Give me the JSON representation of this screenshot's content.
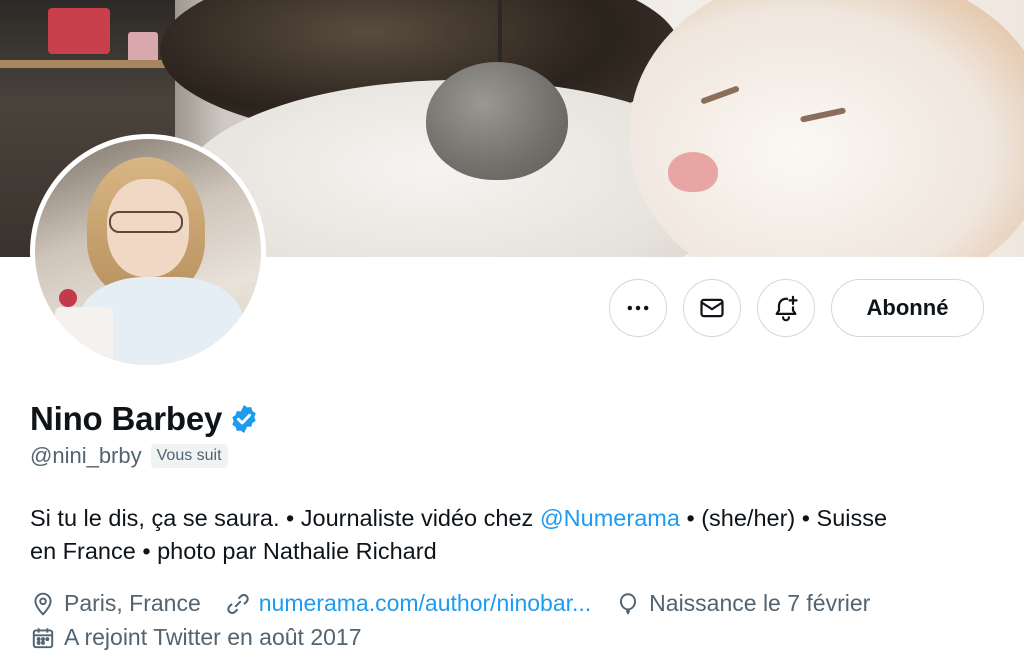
{
  "profile": {
    "name": "Nino Barbey",
    "handle": "@nini_brby",
    "follows_you": "Vous suit",
    "bio": {
      "part1": "Si tu le dis, ça se saura. • Journaliste vidéo chez ",
      "mention": "@Numerama",
      "part2": " • (she/her) • Suisse",
      "line2": "en France • photo par Nathalie Richard"
    },
    "location": "Paris, France",
    "website": "numerama.com/author/ninobar...",
    "birthday": "Naissance le 7 février",
    "joined": "A rejoint Twitter en août 2017"
  },
  "actions": {
    "more_icon": "more-icon",
    "message_icon": "envelope-icon",
    "notify_icon": "bell-plus-icon",
    "follow_label": "Abonné"
  },
  "colors": {
    "accent": "#1d9bf0",
    "secondary_text": "#536471",
    "primary_text": "#0f1419",
    "border": "#cfd9de"
  }
}
